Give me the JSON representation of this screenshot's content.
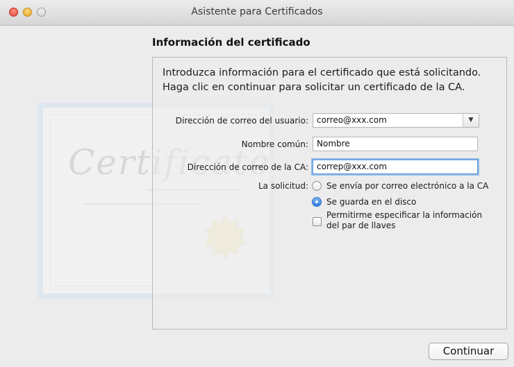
{
  "window": {
    "title": "Asistente para Certificados"
  },
  "decoration": {
    "certificate_word": "Certificate"
  },
  "section": {
    "title": "Información del certificado"
  },
  "intro": "Introduzca información para el certificado que está solicitando. Haga clic en continuar para solicitar un certificado de la CA.",
  "form": {
    "user_email_label": "Dirección de correo del usuario:",
    "user_email_value": "correo@xxx.com",
    "common_name_label": "Nombre común:",
    "common_name_value": "Nombre",
    "ca_email_label": "Dirección de correo de la CA:",
    "ca_email_value": "correp@xxx.com",
    "request_label": "La solicitud:",
    "options": [
      {
        "label": "Se envía por correo electrónico a la CA",
        "selected": false
      },
      {
        "label": "Se guarda en el disco",
        "selected": true
      }
    ],
    "keypair_checkbox_label_line1": "Permitirme especificar la información",
    "keypair_checkbox_label_line2": "del par de llaves",
    "keypair_checked": false
  },
  "buttons": {
    "continue_label": "Continuar"
  },
  "colors": {
    "focus_ring": "#8fbbea",
    "radio_selected": "#2f7fe0",
    "close": "#e0443a",
    "minimize": "#e0a522"
  }
}
